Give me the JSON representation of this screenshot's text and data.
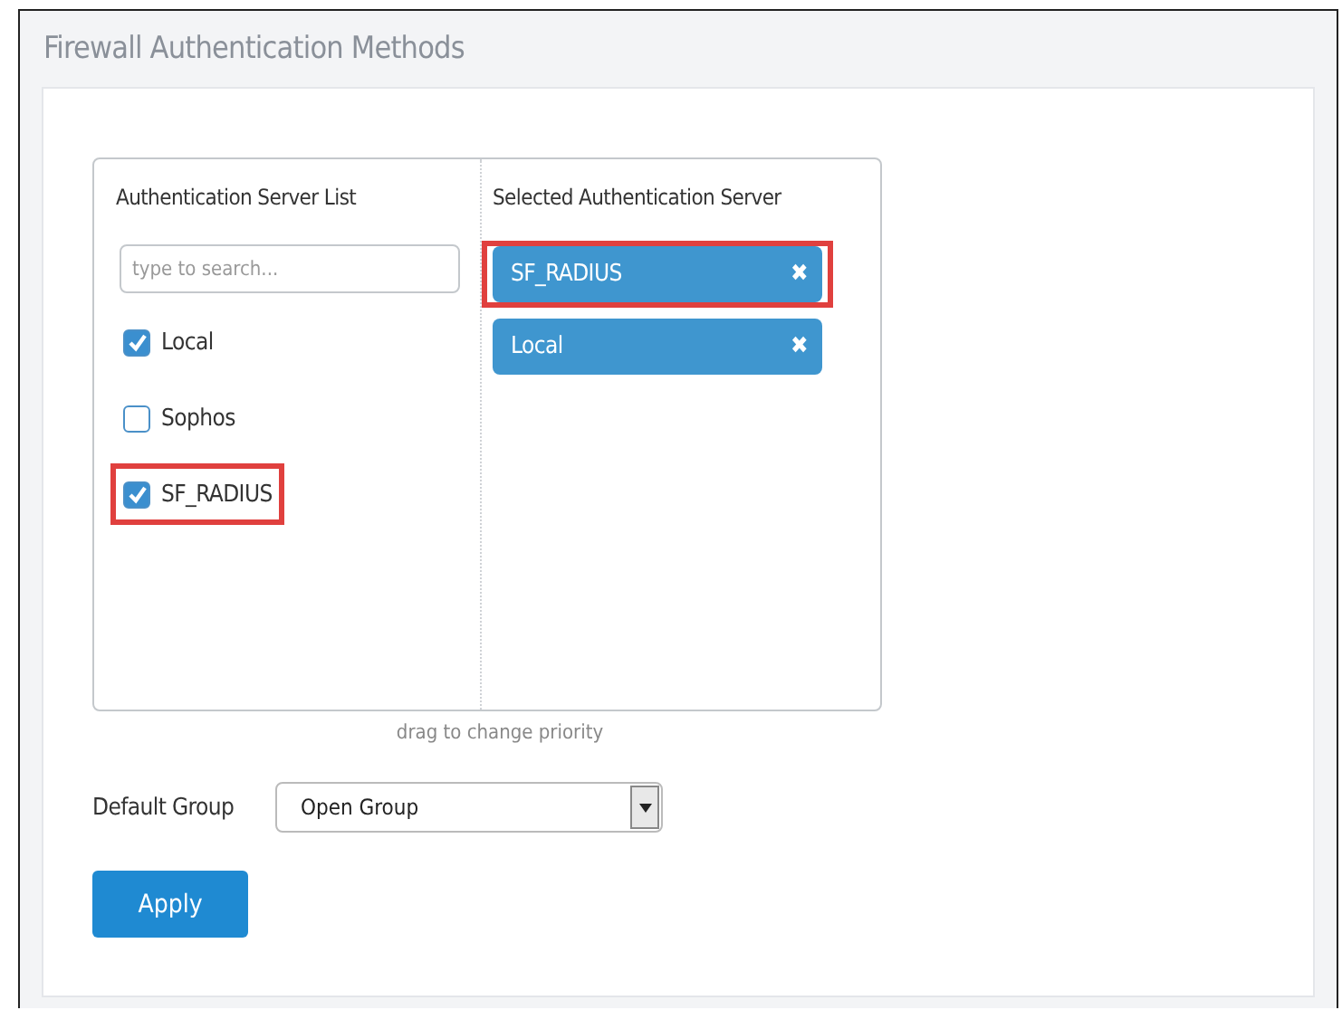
{
  "panel": {
    "title": "Firewall Authentication Methods"
  },
  "server_list": {
    "heading": "Authentication Server List",
    "search": {
      "placeholder": "type to search..."
    },
    "items": [
      {
        "label": "Local",
        "checked": true,
        "highlighted": false
      },
      {
        "label": "Sophos",
        "checked": false,
        "highlighted": false
      },
      {
        "label": "SF_RADIUS",
        "checked": true,
        "highlighted": true
      }
    ]
  },
  "selected_servers": {
    "heading": "Selected Authentication Server",
    "items": [
      {
        "label": "SF_RADIUS",
        "remove": "✖",
        "highlighted": true
      },
      {
        "label": "Local",
        "remove": "✖",
        "highlighted": false
      }
    ]
  },
  "hint": "drag to change priority",
  "default_group": {
    "label": "Default Group",
    "value": "Open Group"
  },
  "buttons": [
    "Apply"
  ]
}
